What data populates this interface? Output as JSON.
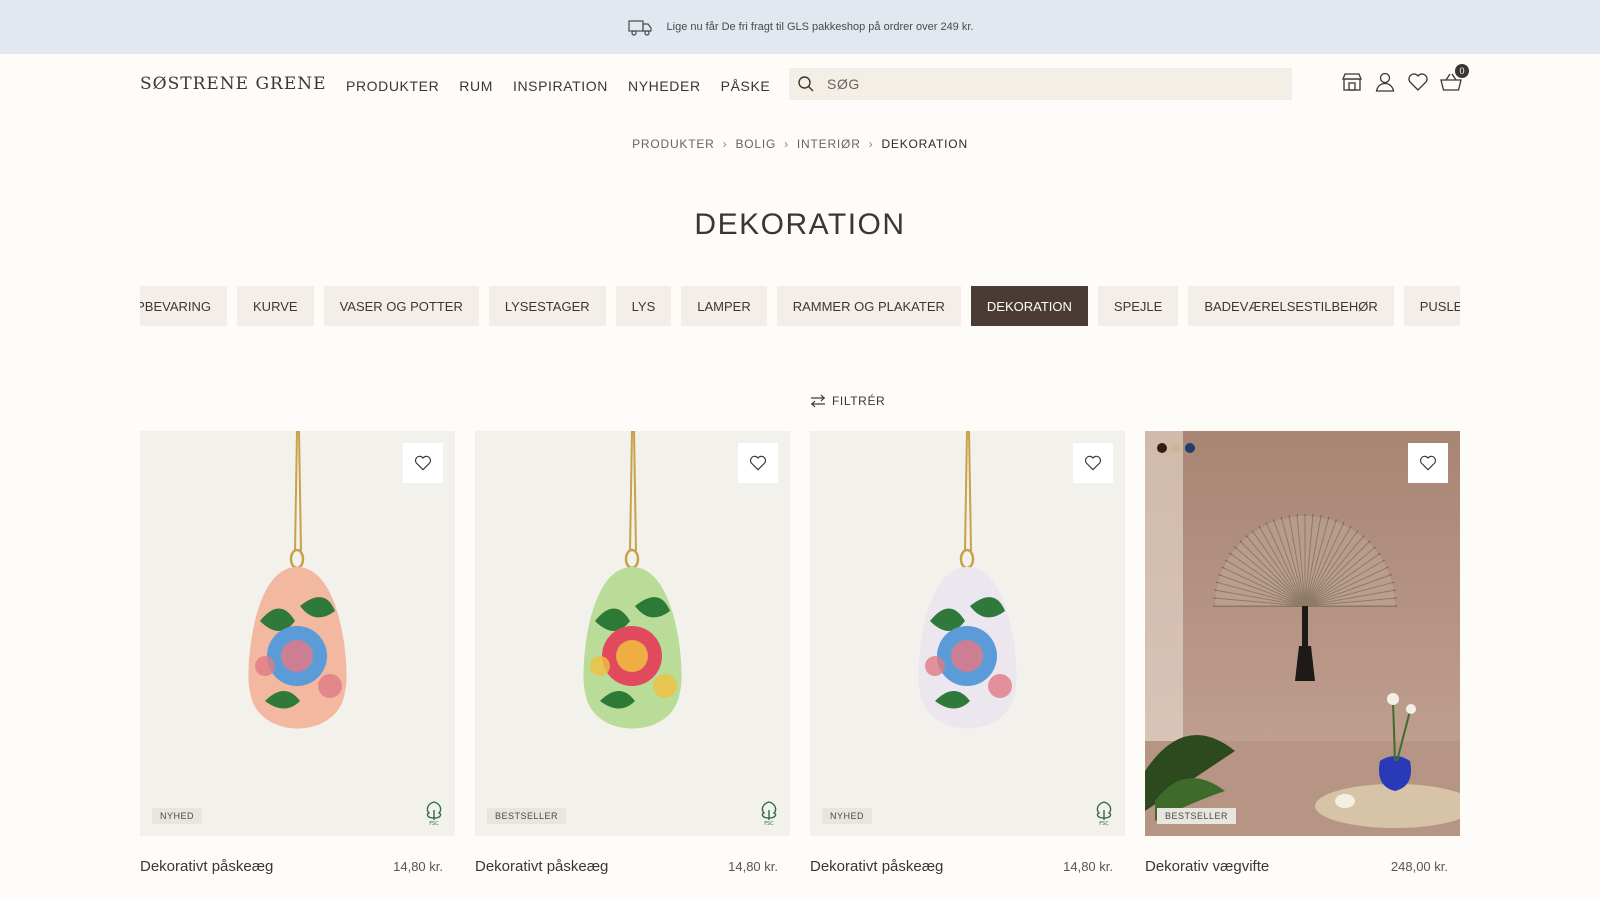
{
  "topbar": {
    "message": "Lige nu får De fri fragt til GLS pakkeshop på ordrer over 249 kr."
  },
  "header": {
    "logo": "SØSTRENE GRENE",
    "nav": [
      "PRODUKTER",
      "RUM",
      "INSPIRATION",
      "NYHEDER",
      "PÅSKE"
    ],
    "search_placeholder": "SØG",
    "cart_count": "0"
  },
  "breadcrumb": [
    "PRODUKTER",
    "BOLIG",
    "INTERIØR",
    "DEKORATION"
  ],
  "page_title": "DEKORATION",
  "categories": [
    {
      "label": "OPBEVARING",
      "active": false
    },
    {
      "label": "KURVE",
      "active": false
    },
    {
      "label": "VASER OG POTTER",
      "active": false
    },
    {
      "label": "LYSESTAGER",
      "active": false
    },
    {
      "label": "LYS",
      "active": false
    },
    {
      "label": "LAMPER",
      "active": false
    },
    {
      "label": "RAMMER OG PLAKATER",
      "active": false
    },
    {
      "label": "DEKORATION",
      "active": true
    },
    {
      "label": "SPEJLE",
      "active": false
    },
    {
      "label": "BADEVÆRELSESTILBEHØR",
      "active": false
    },
    {
      "label": "PUSLESPIL OG SPIL",
      "active": false
    }
  ],
  "filter_label": "FILTRÉR",
  "products": [
    {
      "name": "Dekorativt påskeæg",
      "price": "14,80 kr.",
      "badge": "NYHED",
      "colors": {
        "egg": "#f2b8a0",
        "flower": "#5b9bd8",
        "leaf": "#2f7a3a",
        "accent": "#e07a86"
      }
    },
    {
      "name": "Dekorativt påskeæg",
      "price": "14,80 kr.",
      "badge": "BESTSELLER",
      "colors": {
        "egg": "#b9dc98",
        "flower": "#e14a5c",
        "leaf": "#2d7a36",
        "accent": "#f0c040"
      }
    },
    {
      "name": "Dekorativt påskeæg",
      "price": "14,80 kr.",
      "badge": "NYHED",
      "colors": {
        "egg": "#ece6ef",
        "flower": "#5b9bd8",
        "leaf": "#2f7a3a",
        "accent": "#e07a86"
      }
    },
    {
      "name": "Dekorativ vægvifte",
      "price": "248,00 kr.",
      "badge": "BESTSELLER",
      "swatches": [
        "#3a1a12",
        "#c9b79a",
        "#1e3e6e"
      ]
    }
  ]
}
